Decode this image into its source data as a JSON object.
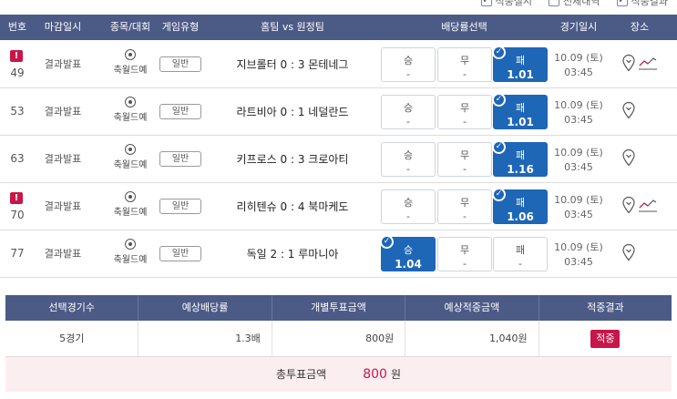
{
  "filters": [
    {
      "label": "적중실시",
      "checked": true
    },
    {
      "label": "전체내역",
      "checked": false
    },
    {
      "label": "적중결과",
      "checked": true
    }
  ],
  "headers": {
    "num": "번호",
    "deadline": "마감일시",
    "sport": "종목/대회",
    "game_type": "게임유형",
    "match": "홈팀 vs 원정팀",
    "odds": "배당률선택",
    "date": "경기일시",
    "venue": "장소"
  },
  "rows": [
    {
      "num": "49",
      "warn": true,
      "deadline": "결과발표",
      "sport": "축월드예",
      "type": "일반",
      "match": "지브롤터 0 : 3 몬테네그",
      "win_label": "승",
      "win_val": "-",
      "draw_label": "무",
      "draw_val": "-",
      "lose_label": "패",
      "lose_val": "1.01",
      "selected": "lose",
      "date": "10.09 (토)",
      "time": "03:45",
      "trend": true
    },
    {
      "num": "53",
      "warn": false,
      "deadline": "결과발표",
      "sport": "축월드예",
      "type": "일반",
      "match": "라트비아 0 : 1 네덜란드",
      "win_label": "승",
      "win_val": "-",
      "draw_label": "무",
      "draw_val": "-",
      "lose_label": "패",
      "lose_val": "1.01",
      "selected": "lose",
      "date": "10.09 (토)",
      "time": "03:45",
      "trend": false
    },
    {
      "num": "63",
      "warn": false,
      "deadline": "결과발표",
      "sport": "축월드예",
      "type": "일반",
      "match": "키프로스 0 : 3 크로아티",
      "win_label": "승",
      "win_val": "-",
      "draw_label": "무",
      "draw_val": "-",
      "lose_label": "패",
      "lose_val": "1.16",
      "selected": "lose",
      "date": "10.09 (토)",
      "time": "03:45",
      "trend": false
    },
    {
      "num": "70",
      "warn": true,
      "deadline": "결과발표",
      "sport": "축월드예",
      "type": "일반",
      "match": "리히텐슈 0 : 4 북마케도",
      "win_label": "승",
      "win_val": "-",
      "draw_label": "무",
      "draw_val": "-",
      "lose_label": "패",
      "lose_val": "1.06",
      "selected": "lose",
      "date": "10.09 (토)",
      "time": "03:45",
      "trend": true
    },
    {
      "num": "77",
      "warn": false,
      "deadline": "결과발표",
      "sport": "축월드예",
      "type": "일반",
      "match": "독일 2 : 1 루마니아",
      "win_label": "승",
      "win_val": "1.04",
      "draw_label": "무",
      "draw_val": "-",
      "lose_label": "패",
      "lose_val": "-",
      "selected": "win",
      "date": "10.09 (토)",
      "time": "03:45",
      "trend": false
    }
  ],
  "summary": {
    "headers": [
      "선택경기수",
      "예상배당률",
      "개별투표금액",
      "예상적중금액",
      "적중결과"
    ],
    "games": "5경기",
    "odds": "1.3배",
    "bet": "800원",
    "expected": "1,040원",
    "result": "적중",
    "total_label": "총투표금액",
    "total_amount": "800",
    "total_unit": "원"
  },
  "colors": {
    "header": "#4c5a86",
    "selected": "#1e66b6",
    "accent": "#c8164a",
    "total_bg": "#fbeef1"
  },
  "icons": {
    "sport": "soccer-ball-icon",
    "venue": "location-pin-icon",
    "trend": "trend-chart-icon"
  }
}
